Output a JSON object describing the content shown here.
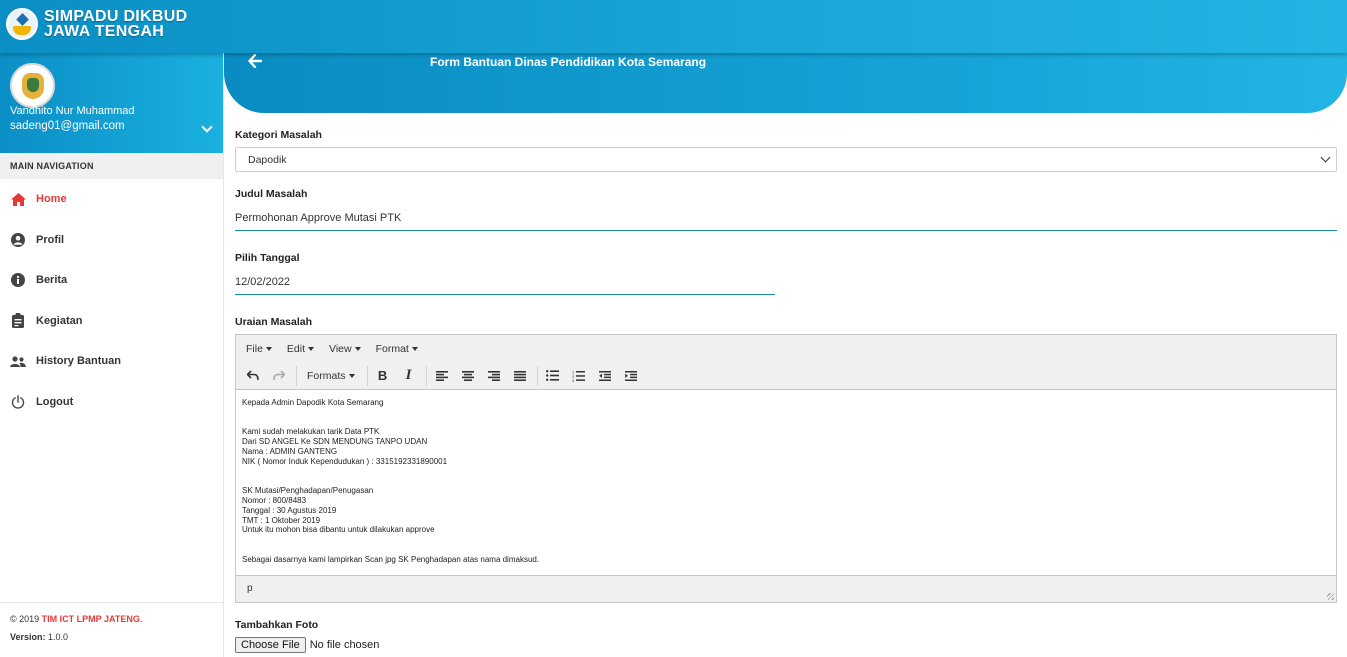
{
  "brand": {
    "line1": "SIMPADU DIKBUD",
    "line2": "JAWA TENGAH"
  },
  "user": {
    "name": "Vandhito Nur Muhammad",
    "email": "sadeng01@gmail.com"
  },
  "nav": {
    "header": "MAIN NAVIGATION",
    "items": [
      {
        "label": "Home",
        "icon": "home-icon",
        "active": true
      },
      {
        "label": "Profil",
        "icon": "user-circle-icon"
      },
      {
        "label": "Berita",
        "icon": "info-icon"
      },
      {
        "label": "Kegiatan",
        "icon": "clipboard-icon"
      },
      {
        "label": "History Bantuan",
        "icon": "users-icon"
      },
      {
        "label": "Logout",
        "icon": "power-icon"
      }
    ]
  },
  "footer": {
    "copyright": "© 2019 ",
    "org": "TIM ICT LPMP JATENG",
    "dot": ".",
    "version_label": "Version:",
    "version": " 1.0.0"
  },
  "banner": {
    "title": "Form Bantuan Dinas Pendidikan Kota Semarang"
  },
  "form": {
    "kategori_label": "Kategori Masalah",
    "kategori_value": "Dapodik",
    "judul_label": "Judul Masalah",
    "judul_value": "Permohonan Approve Mutasi PTK",
    "tanggal_label": "Pilih Tanggal",
    "tanggal_value": "12/02/2022",
    "uraian_label": "Uraian Masalah",
    "foto_label": "Tambahkan Foto",
    "file_button": "Choose File",
    "file_status": "No file chosen"
  },
  "editor": {
    "menus": [
      "File",
      "Edit",
      "View",
      "Format"
    ],
    "formats_label": "Formats",
    "status_path": "p",
    "lines": {
      "l1": "Kepada Admin Dapodik Kota Semarang",
      "l2": "Kami sudah melakukan tarik Data PTK",
      "l3": "Dari SD ANGEL Ke SDN MENDUNG TANPO UDAN",
      "l4": "Nama : ADMIN GANTENG",
      "l5": "NIK ( Nomor Induk Kependudukan ) : 3315192331890001",
      "l6": "SK Mutasi/Penghadapan/Penugasan",
      "l7": "Nomor : 800/8483",
      "l8": "Tanggal : 30 Agustus 2019",
      "l9": "TMT : 1 Oktober 2019",
      "l10": "Untuk itu mohon bisa dibantu untuk dilakukan approve",
      "l11": "Sebagai dasarnya kami lampirkan Scan jpg SK Penghadapan atas nama dimaksud."
    }
  },
  "colors": {
    "accent": "#1aa7d8",
    "active": "#e53935",
    "underline": "#1b8fa6"
  }
}
